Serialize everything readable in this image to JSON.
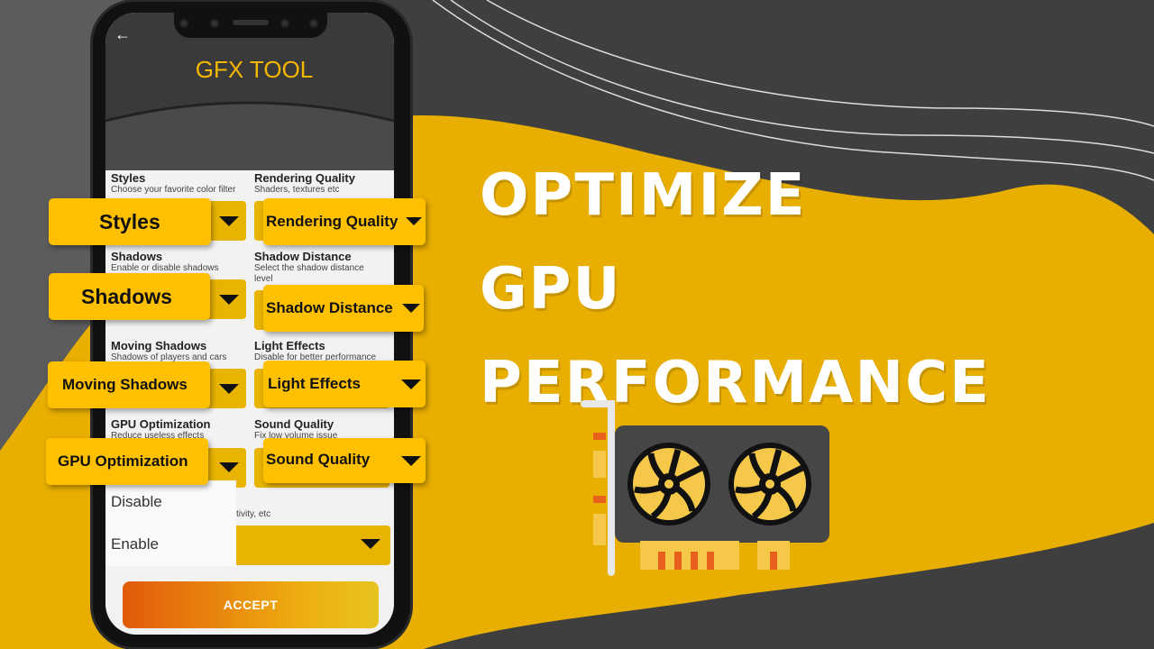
{
  "app": {
    "title": "GFX TOOL",
    "back_icon": "arrow-left-icon"
  },
  "sections": [
    {
      "title": "Styles",
      "subtitle": "Choose your favorite color filter",
      "label": "Styles"
    },
    {
      "title": "Rendering Quality",
      "subtitle": "Shaders, textures etc",
      "label": "Rendering Quality"
    },
    {
      "title": "Shadows",
      "subtitle": "Enable or disable shadows",
      "label": "Shadows"
    },
    {
      "title": "Shadow Distance",
      "subtitle": "Select the shadow distance level",
      "label": "Shadow Distance"
    },
    {
      "title": "Moving Shadows",
      "subtitle": "Shadows of players and cars",
      "label": "Moving Shadows"
    },
    {
      "title": "Light Effects",
      "subtitle": "Disable for better performance",
      "label": "Light Effects"
    },
    {
      "title": "GPU Optimization",
      "subtitle": "Reduce useless effects",
      "label": "GPU Optimization"
    },
    {
      "title": "Sound Quality",
      "subtitle": "Fix low volume issue",
      "label": "Sound Quality"
    }
  ],
  "partial_subtitle": "tivity, etc",
  "dropdown_menu": {
    "options": [
      "Disable",
      "Enable"
    ]
  },
  "accept_label": "ACCEPT",
  "headline": {
    "line1": "OPTIMIZE",
    "line2": "GPU",
    "line3": "PERFORMANCE"
  },
  "colors": {
    "accent": "#ffc000",
    "background_dark": "#404040",
    "wave_yellow": "#e8ae00",
    "title": "#f5b800"
  }
}
